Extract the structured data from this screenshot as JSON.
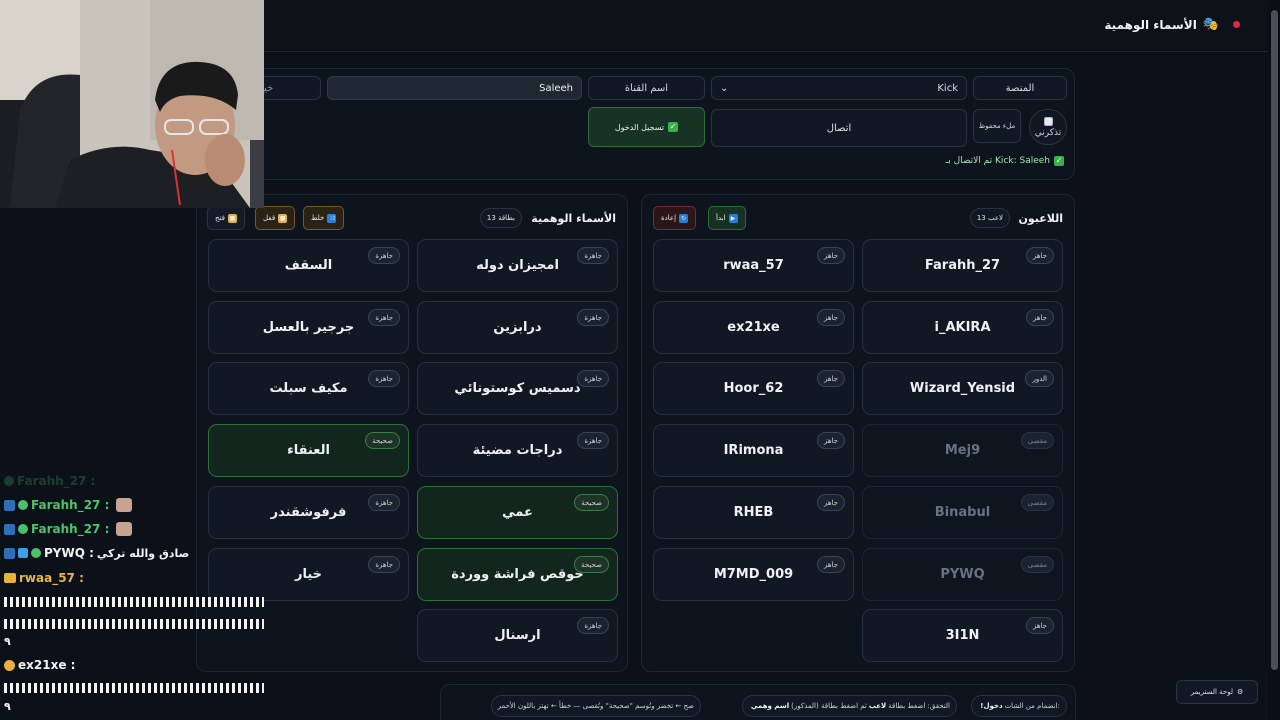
{
  "header": {
    "title": "الأسماء الوهمية"
  },
  "settings": {
    "platform_label": "المنصة",
    "platform_value": "Kick",
    "channel_label": "اسم القناة",
    "channel_value": "Saleeh",
    "clipped_field_text": "خيا",
    "remember_label": "تذكرني",
    "autofill_label": "ملء محفوظ",
    "connect_label": "اتصال",
    "login_label": "تسجيل الدخول",
    "status_text": "تم الاتصال بـ Kick: Saleeh"
  },
  "players_panel": {
    "title": "اللاعبون",
    "count": "13 لاعب",
    "start_label": "ابدأ",
    "reset_label": "إعادة",
    "players": [
      {
        "name": "Farahh_27",
        "tag": "جاهز",
        "state": "ready"
      },
      {
        "name": "rwaa_57",
        "tag": "جاهز",
        "state": "ready"
      },
      {
        "name": "i_AKIRA",
        "tag": "جاهز",
        "state": "ready"
      },
      {
        "name": "ex21xe",
        "tag": "جاهز",
        "state": "ready"
      },
      {
        "name": "Wizard_Yensid",
        "tag": "الدور",
        "state": "ready"
      },
      {
        "name": "Hoor_62",
        "tag": "جاهز",
        "state": "ready"
      },
      {
        "name": "Mej9",
        "tag": "مقصى",
        "state": "out"
      },
      {
        "name": "IRimona",
        "tag": "جاهز",
        "state": "ready"
      },
      {
        "name": "Binabul",
        "tag": "مقصى",
        "state": "out"
      },
      {
        "name": "RHEB",
        "tag": "جاهز",
        "state": "ready"
      },
      {
        "name": "PYWQ",
        "tag": "مقصى",
        "state": "out"
      },
      {
        "name": "M7MD_009",
        "tag": "جاهز",
        "state": "ready"
      },
      {
        "name": "3I1N",
        "tag": "جاهز",
        "state": "ready"
      }
    ]
  },
  "names_panel": {
    "title": "الأسماء الوهمية",
    "count": "13 بطاقة",
    "shuffle_label": "خلط",
    "lock_label": "قفل",
    "open_label": "فتح",
    "names": [
      {
        "name": "امجيزان دوله",
        "tag": "جاهزة",
        "state": "ready"
      },
      {
        "name": "السقف",
        "tag": "جاهزة",
        "state": "ready"
      },
      {
        "name": "درابزين",
        "tag": "جاهزة",
        "state": "ready"
      },
      {
        "name": "جرجير بالعسل",
        "tag": "جاهزة",
        "state": "ready"
      },
      {
        "name": "دسميس كوستونائي",
        "tag": "جاهزة",
        "state": "ready"
      },
      {
        "name": "مكيف سبلت",
        "tag": "جاهزة",
        "state": "ready"
      },
      {
        "name": "دراجات مضيئة",
        "tag": "جاهزة",
        "state": "ready"
      },
      {
        "name": "العنقاء",
        "tag": "صحيحة",
        "state": "correct"
      },
      {
        "name": "عمي",
        "tag": "صحيحة",
        "state": "correct"
      },
      {
        "name": "فرفوشقندر",
        "tag": "جاهزة",
        "state": "ready"
      },
      {
        "name": "حوقص فراشة ووردة",
        "tag": "صحيحة",
        "state": "correct"
      },
      {
        "name": "خيار",
        "tag": "جاهزة",
        "state": "ready"
      },
      {
        "name": "ارسنال",
        "tag": "جاهزة",
        "state": "ready"
      }
    ]
  },
  "hints": {
    "h1_prefix": "انضمام من الشات:",
    "h1_bold": "!دخول",
    "h2_prefix": "التحقق: اضغط بطاقة",
    "h2_bold1": "لاعب",
    "h2_mid": "(المذكور) ثم اضغط بطاقة",
    "h2_bold2": "اسم وهمي",
    "h3": "صح ← تخضر وتُوسم \"صحيحة\" وتُقصى — خطأ ← تهتز باللون الأحمر"
  },
  "dashboard_label": "لوحة الستريمر",
  "chat": {
    "lines": [
      {
        "user": "Farahh_27 :",
        "msg": ""
      },
      {
        "user": "Farahh_27 :",
        "msg": ""
      },
      {
        "user": "PYWQ :",
        "msg": "صادق والله تركي"
      },
      {
        "user": "rwaa_57 :",
        "msg": ""
      },
      {
        "user": "ex21xe :",
        "msg": ""
      }
    ],
    "short_text": "٩"
  },
  "colors": {
    "background": "#0c1119",
    "correct_green": "#13261d",
    "accent_red": "#e0284a",
    "chat_green": "#4fc36b"
  }
}
